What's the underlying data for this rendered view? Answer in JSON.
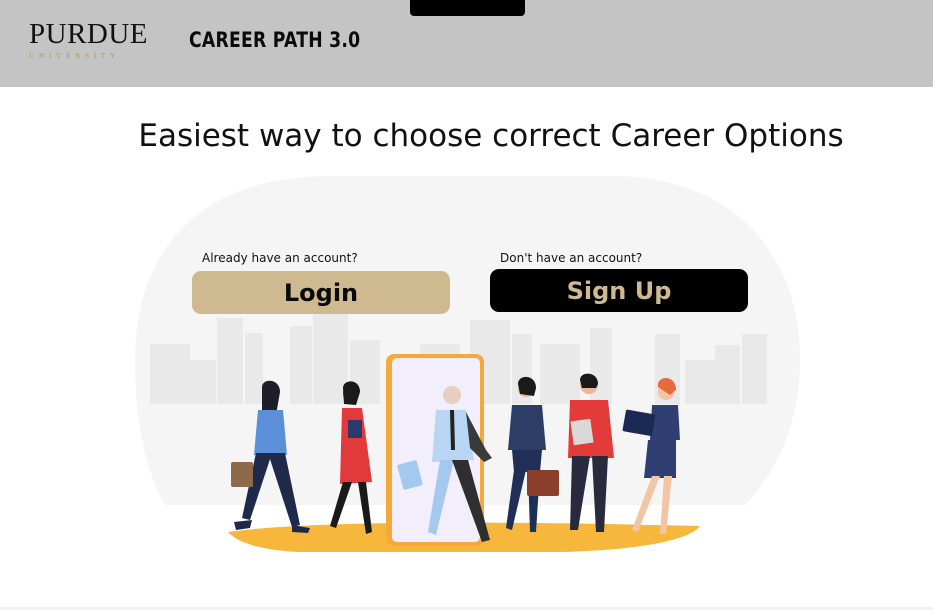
{
  "header": {
    "logo_wordmark": "PURDUE",
    "logo_subtitle": "UNIVERSITY",
    "app_title": "CAREER PATH 3.0"
  },
  "main": {
    "headline": "Easiest way to choose correct Career Options"
  },
  "auth": {
    "login_prompt": "Already have an account?",
    "login_label": "Login",
    "signup_prompt": "Don't have an account?",
    "signup_label": "Sign Up"
  },
  "colors": {
    "header_bg": "#c4c4c4",
    "gold": "#cfb991",
    "black": "#000000"
  },
  "icons": {
    "illustration": "career-people-walking-through-door"
  }
}
